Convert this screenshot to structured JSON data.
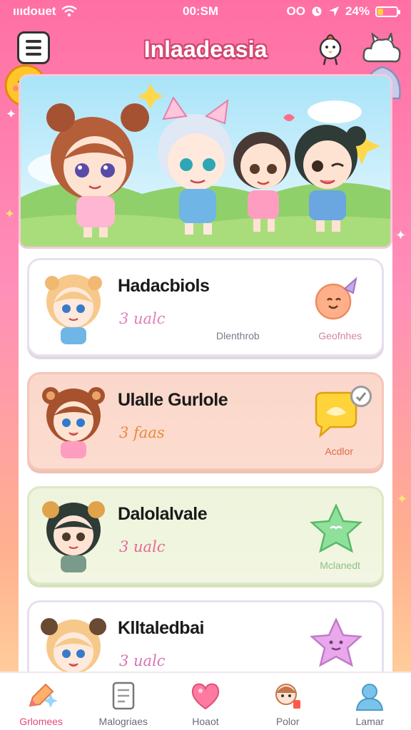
{
  "status_bar": {
    "carrier": "ıııdouet",
    "time": "00:SM",
    "indicators": "OO",
    "battery_text": "24%",
    "battery_level": 0.3,
    "icons": [
      "wifi-icon",
      "alarm-icon",
      "location-icon",
      "battery-icon"
    ]
  },
  "header": {
    "title": "Inlaadeasia",
    "menu_icon": "menu-icon",
    "mascot_icon": "chick-mascot-icon",
    "cloud_icon": "cloud-bunny-icon"
  },
  "hero": {
    "icon": "chibi-group-banner"
  },
  "cards": [
    {
      "title": "Hadacbiols",
      "subtitle": "3 ualc",
      "meta": "Dlenthrob",
      "action": "Geofnhes",
      "sticker_icon": "ice-cream-icon",
      "avatar_icon": "blonde-chibi-avatar"
    },
    {
      "title": "Ulalle Gurlole",
      "subtitle": "3 faas",
      "meta": "",
      "action": "Acdlor",
      "sticker_icon": "chat-bubble-icon",
      "avatar_icon": "brown-bear-chibi-avatar"
    },
    {
      "title": "Dalolalvale",
      "subtitle": "3 ualc",
      "meta": "",
      "action": "Mclanedt",
      "sticker_icon": "star-icon",
      "avatar_icon": "dark-hair-chibi-avatar"
    },
    {
      "title": "Klltaledbai",
      "subtitle": "3 ualc",
      "meta": "",
      "action": "",
      "sticker_icon": "purple-star-icon",
      "avatar_icon": "bear-ears-chibi-avatar"
    }
  ],
  "bottom_nav": [
    {
      "label": "Grlomees",
      "icon": "sparkle-pencil-icon",
      "active": true
    },
    {
      "label": "Malogriaes",
      "icon": "notebook-icon",
      "active": false
    },
    {
      "label": "Hoaot",
      "icon": "heart-icon",
      "active": false
    },
    {
      "label": "Polor",
      "icon": "character-icon",
      "active": false
    },
    {
      "label": "Lamar",
      "icon": "profile-icon",
      "active": false
    }
  ],
  "colors": {
    "accent": "#e24a78",
    "background_top": "#ff6fa3",
    "background_bottom": "#ffd9a0"
  }
}
